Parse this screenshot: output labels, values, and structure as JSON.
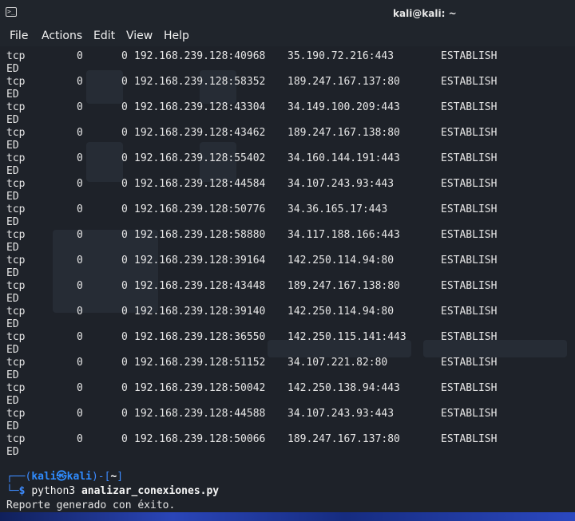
{
  "window": {
    "title": "kali@kali: ~",
    "icon": "terminal-icon"
  },
  "menu": [
    "File",
    "Actions",
    "Edit",
    "View",
    "Help"
  ],
  "connections": [
    {
      "proto": "tcp",
      "recv": "0",
      "send": "0",
      "local": "192.168.239.128:40968",
      "foreign": "35.190.72.216:443",
      "state": "ESTABLISH",
      "wrap": "ED"
    },
    {
      "proto": "tcp",
      "recv": "0",
      "send": "0",
      "local": "192.168.239.128:58352",
      "foreign": "189.247.167.137:80",
      "state": "ESTABLISH",
      "wrap": "ED"
    },
    {
      "proto": "tcp",
      "recv": "0",
      "send": "0",
      "local": "192.168.239.128:43304",
      "foreign": "34.149.100.209:443",
      "state": "ESTABLISH",
      "wrap": "ED"
    },
    {
      "proto": "tcp",
      "recv": "0",
      "send": "0",
      "local": "192.168.239.128:43462",
      "foreign": "189.247.167.138:80",
      "state": "ESTABLISH",
      "wrap": "ED"
    },
    {
      "proto": "tcp",
      "recv": "0",
      "send": "0",
      "local": "192.168.239.128:55402",
      "foreign": "34.160.144.191:443",
      "state": "ESTABLISH",
      "wrap": "ED"
    },
    {
      "proto": "tcp",
      "recv": "0",
      "send": "0",
      "local": "192.168.239.128:44584",
      "foreign": "34.107.243.93:443",
      "state": "ESTABLISH",
      "wrap": "ED"
    },
    {
      "proto": "tcp",
      "recv": "0",
      "send": "0",
      "local": "192.168.239.128:50776",
      "foreign": "34.36.165.17:443",
      "state": "ESTABLISH",
      "wrap": "ED"
    },
    {
      "proto": "tcp",
      "recv": "0",
      "send": "0",
      "local": "192.168.239.128:58880",
      "foreign": "34.117.188.166:443",
      "state": "ESTABLISH",
      "wrap": "ED"
    },
    {
      "proto": "tcp",
      "recv": "0",
      "send": "0",
      "local": "192.168.239.128:39164",
      "foreign": "142.250.114.94:80",
      "state": "ESTABLISH",
      "wrap": "ED"
    },
    {
      "proto": "tcp",
      "recv": "0",
      "send": "0",
      "local": "192.168.239.128:43448",
      "foreign": "189.247.167.138:80",
      "state": "ESTABLISH",
      "wrap": "ED"
    },
    {
      "proto": "tcp",
      "recv": "0",
      "send": "0",
      "local": "192.168.239.128:39140",
      "foreign": "142.250.114.94:80",
      "state": "ESTABLISH",
      "wrap": "ED"
    },
    {
      "proto": "tcp",
      "recv": "0",
      "send": "0",
      "local": "192.168.239.128:36550",
      "foreign": "142.250.115.141:443",
      "state": "ESTABLISH",
      "wrap": "ED"
    },
    {
      "proto": "tcp",
      "recv": "0",
      "send": "0",
      "local": "192.168.239.128:51152",
      "foreign": "34.107.221.82:80",
      "state": "ESTABLISH",
      "wrap": "ED"
    },
    {
      "proto": "tcp",
      "recv": "0",
      "send": "0",
      "local": "192.168.239.128:50042",
      "foreign": "142.250.138.94:443",
      "state": "ESTABLISH",
      "wrap": "ED"
    },
    {
      "proto": "tcp",
      "recv": "0",
      "send": "0",
      "local": "192.168.239.128:44588",
      "foreign": "34.107.243.93:443",
      "state": "ESTABLISH",
      "wrap": "ED"
    },
    {
      "proto": "tcp",
      "recv": "0",
      "send": "0",
      "local": "192.168.239.128:50066",
      "foreign": "189.247.167.137:80",
      "state": "ESTABLISH",
      "wrap": "ED"
    }
  ],
  "prompt": {
    "open": "┌──(",
    "user": "kali㉿kali",
    "mid": ")-[",
    "dir": "~",
    "close": "]",
    "corner": "└─",
    "dollar": "$",
    "command": "python3",
    "argument": "analizar_conexiones.py"
  },
  "output": "Reporte generado con éxito.",
  "colors": {
    "background": "#1e2229",
    "prompt_blue": "#3d8bff",
    "text": "#e6e6e6"
  }
}
